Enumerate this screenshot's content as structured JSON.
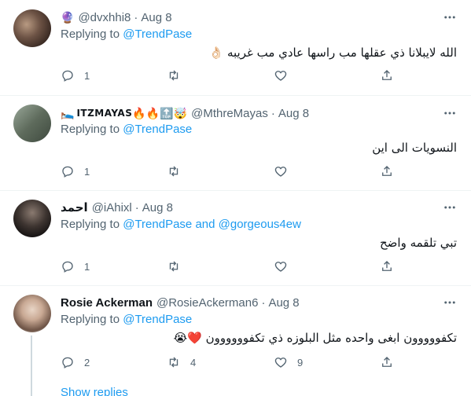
{
  "tweets": [
    {
      "display_name": "",
      "name_prefix_emoji": "🔮",
      "handle": "@dvxhhi8",
      "date": "Aug 8",
      "replying_label": "Replying to",
      "replying_to": "@TrendPase",
      "replying_to_2": "",
      "text": "الله لايبلانا ذي عقلها مب راسها عادي مب غريبه",
      "text_emoji": "👌🏻",
      "counts": {
        "reply": "1",
        "retweet": "",
        "like": ""
      }
    },
    {
      "display_name": "ITZMAYAS",
      "name_prefix_emoji": "🛌",
      "name_emojis": [
        "🔥",
        "🔥",
        "🔝",
        "🤯"
      ],
      "handle": "@MthreMayas",
      "date": "Aug 8",
      "replying_label": "Replying to",
      "replying_to": "@TrendPase",
      "replying_to_2": "",
      "text": "النسويات الى اين",
      "text_emoji": "",
      "counts": {
        "reply": "1",
        "retweet": "",
        "like": ""
      }
    },
    {
      "display_name": "احمد",
      "handle": "@iAhixl",
      "date": "Aug 8",
      "replying_label": "Replying to",
      "replying_to": "@TrendPase",
      "replying_and": "and",
      "replying_to_2": "@gorgeous4ew",
      "text": "تبي تلقمه واضح",
      "text_emoji": "",
      "counts": {
        "reply": "1",
        "retweet": "",
        "like": ""
      }
    },
    {
      "display_name": "Rosie Ackerman",
      "handle": "@RosieAckerman6",
      "date": "Aug 8",
      "replying_label": "Replying to",
      "replying_to": "@TrendPase",
      "replying_to_2": "",
      "text": "تكفووووون ابغى واحده مثل البلوزه ذي تكفوووووون",
      "text_emoji": "❤️😭",
      "counts": {
        "reply": "2",
        "retweet": "4",
        "like": "9"
      }
    }
  ],
  "show_replies": "Show replies",
  "colors": {
    "accent": "#1d9bf0",
    "muted": "#536471",
    "text": "#0f1419",
    "border": "#eff3f4"
  }
}
